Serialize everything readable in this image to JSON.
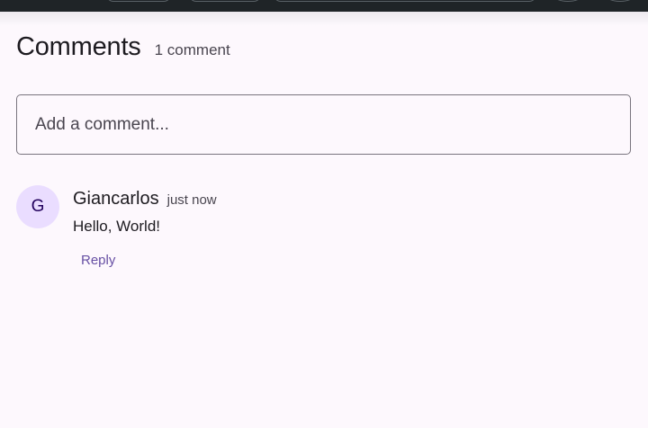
{
  "comments_section": {
    "title": "Comments",
    "count_text": "1 comment",
    "input": {
      "placeholder": "Add a comment..."
    },
    "comments": [
      {
        "avatar_initial": "G",
        "author": "Giancarlos",
        "time": "just now",
        "text": "Hello, World!",
        "reply_label": "Reply"
      }
    ]
  },
  "colors": {
    "background": "#fdf8fd",
    "top_bar": "#1f2427",
    "avatar_bg": "#eaddff",
    "avatar_text": "#21005d",
    "accent": "#6750a4",
    "outline": "#79747e"
  }
}
